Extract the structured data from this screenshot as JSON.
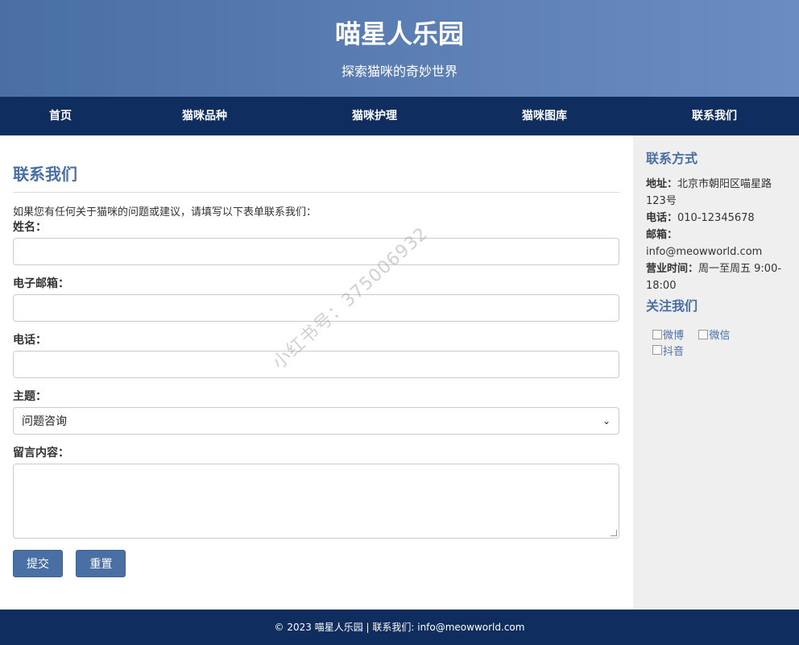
{
  "header": {
    "title": "喵星人乐园",
    "subtitle": "探索猫咪的奇妙世界"
  },
  "nav": {
    "items": [
      "首页",
      "猫咪品种",
      "猫咪护理",
      "猫咪图库",
      "联系我们"
    ]
  },
  "main": {
    "heading": "联系我们",
    "intro": "如果您有任何关于猫咪的问题或建议，请填写以下表单联系我们：",
    "fields": [
      {
        "label": "姓名：",
        "value": ""
      },
      {
        "label": "电子邮箱：",
        "value": ""
      },
      {
        "label": "电话：",
        "value": ""
      },
      {
        "label": "主题：",
        "selected": "问题咨询"
      },
      {
        "label": "留言内容：",
        "value": ""
      }
    ],
    "submit_label": "提交",
    "reset_label": "重置"
  },
  "sidebar": {
    "contact_heading": "联系方式",
    "address_label": "地址：",
    "address_value": "北京市朝阳区喵星路123号",
    "phone_label": "电话：",
    "phone_value": "010-12345678",
    "email_label": "邮箱：",
    "email_value": "info@meowworld.com",
    "hours_label": "营业时间：",
    "hours_value": "周一至周五 9:00-18:00",
    "follow_heading": "关注我们",
    "social": [
      "微博",
      "微信",
      "抖音"
    ]
  },
  "footer": {
    "text": "© 2023 喵星人乐园 | 联系我们: info@meowworld.com"
  },
  "watermark": {
    "text": "小红书号：375006932"
  },
  "colors": {
    "primary": "#4a6fa5",
    "nav_bg": "#0f2d5e",
    "sidebar_bg": "#efefef"
  }
}
